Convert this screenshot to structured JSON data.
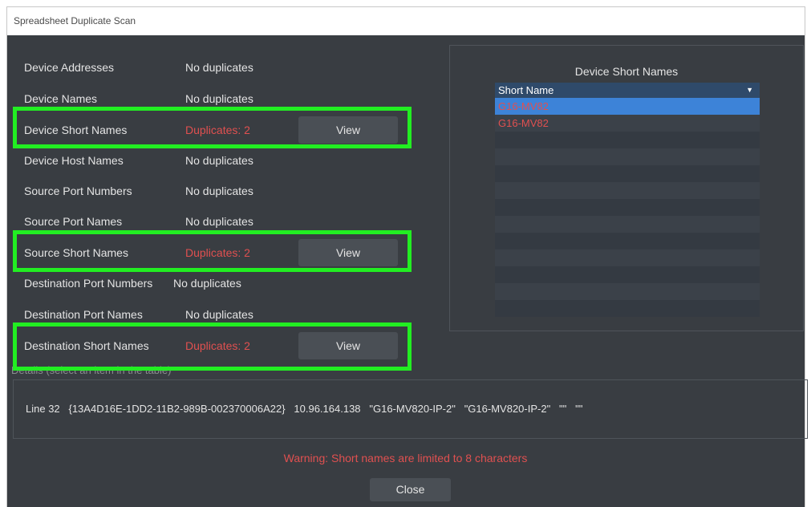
{
  "window": {
    "title": "Spreadsheet Duplicate Scan"
  },
  "scan_rows": [
    {
      "label": "Device Addresses",
      "status": "No duplicates"
    },
    {
      "label": "Device Names",
      "status": "No duplicates"
    },
    {
      "label": "Device Short Names",
      "status": "Duplicates: 2",
      "button": "View"
    },
    {
      "label": "Device Host Names",
      "status": "No duplicates"
    },
    {
      "label": "Source Port Numbers",
      "status": "No duplicates"
    },
    {
      "label": "Source Port Names",
      "status": "No duplicates"
    },
    {
      "label": "Source Short Names",
      "status": "Duplicates: 2",
      "button": "View"
    },
    {
      "label": "Destination Port Numbers",
      "status": "No duplicates"
    },
    {
      "label": "Destination Port Names",
      "status": "No duplicates"
    },
    {
      "label": "Destination Short Names",
      "status": "Duplicates: 2",
      "button": "View"
    }
  ],
  "panel": {
    "title": "Device Short Names",
    "column_header": "Short Name",
    "rows": [
      "G16-MV82",
      "G16-MV82"
    ]
  },
  "details": {
    "label": "Details (select an item in the table)",
    "line": "Line 32   {13A4D16E-1DD2-11B2-989B-002370006A22}   10.96.164.138   \"G16-MV820-IP-2\"   \"G16-MV820-IP-2\"   \"\"   \"\""
  },
  "warning": "Warning: Short names are limited to 8 characters",
  "close_label": "Close",
  "colors": {
    "highlight": "#22ee22",
    "duplicate": "#e05050",
    "selected_row": "#3d83d8"
  }
}
